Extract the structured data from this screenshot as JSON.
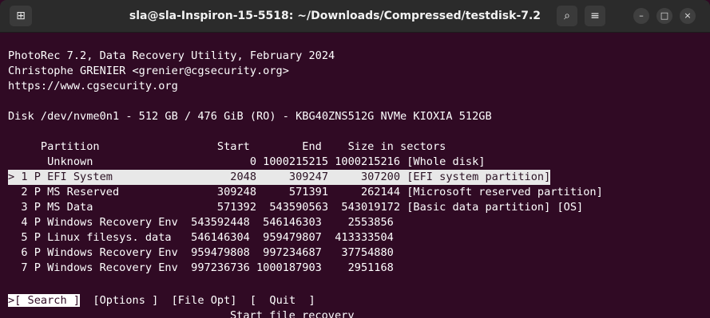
{
  "window": {
    "title": "sla@sla-Inspiron-15-5518: ~/Downloads/Compressed/testdisk-7.2",
    "new_tab_glyph": "⊞",
    "search_glyph": "⌕",
    "menu_glyph": "≡",
    "minimize_glyph": "–",
    "maximize_glyph": "□",
    "close_glyph": "×"
  },
  "terminal": {
    "header": {
      "line1": "PhotoRec 7.2, Data Recovery Utility, February 2024",
      "line2": "Christophe GRENIER <grenier@cgsecurity.org>",
      "line3": "https://www.cgsecurity.org"
    },
    "disk_line": "Disk /dev/nvme0n1 - 512 GB / 476 GiB (RO) - KBG40ZNS512G NVMe KIOXIA 512GB",
    "table_header": "     Partition                  Start        End    Size in sectors",
    "rows": [
      "      Unknown                        0 1000215215 1000215216 [Whole disk]",
      "> 1 P EFI System                  2048     309247     307200 [EFI system partition]",
      "  2 P MS Reserved               309248     571391     262144 [Microsoft reserved partition]",
      "  3 P MS Data                   571392  543590563  543019172 [Basic data partition] [OS]",
      "  4 P Windows Recovery Env  543592448  546146303    2553856",
      "  5 P Linux filesys. data   546146304  959479807  413333504",
      "  6 P Windows Recovery Env  959479808  997234687   37754880",
      "  7 P Windows Recovery Env  997236736 1000187903    2951168"
    ],
    "selected_row_index": 1,
    "menu": {
      "search": ">[ Search ]",
      "options": "[Options ]",
      "file_opt": "[File Opt]",
      "quit": "[  Quit  ]"
    },
    "help_text": "Start file recovery"
  }
}
